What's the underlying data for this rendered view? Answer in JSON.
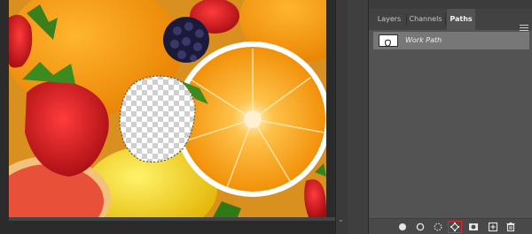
{
  "window": {
    "title": ""
  },
  "panel": {
    "tabs": [
      {
        "label": "Layers",
        "active": false
      },
      {
        "label": "Channels",
        "active": false
      },
      {
        "label": "Paths",
        "active": true
      }
    ],
    "menu_icon": "hamburger-icon",
    "paths": [
      {
        "name": "Work Path",
        "selected": true
      }
    ],
    "footer_icons": [
      "fill-path-icon",
      "stroke-path-icon",
      "load-path-as-selection-icon",
      "make-work-path-from-selection-icon",
      "add-mask-icon",
      "create-new-path-icon",
      "delete-path-icon"
    ],
    "highlighted_icon": "make-work-path-from-selection-icon"
  },
  "colors": {
    "highlight": "#e0282a",
    "panel_bg": "#535353",
    "selected_row": "#777777"
  }
}
